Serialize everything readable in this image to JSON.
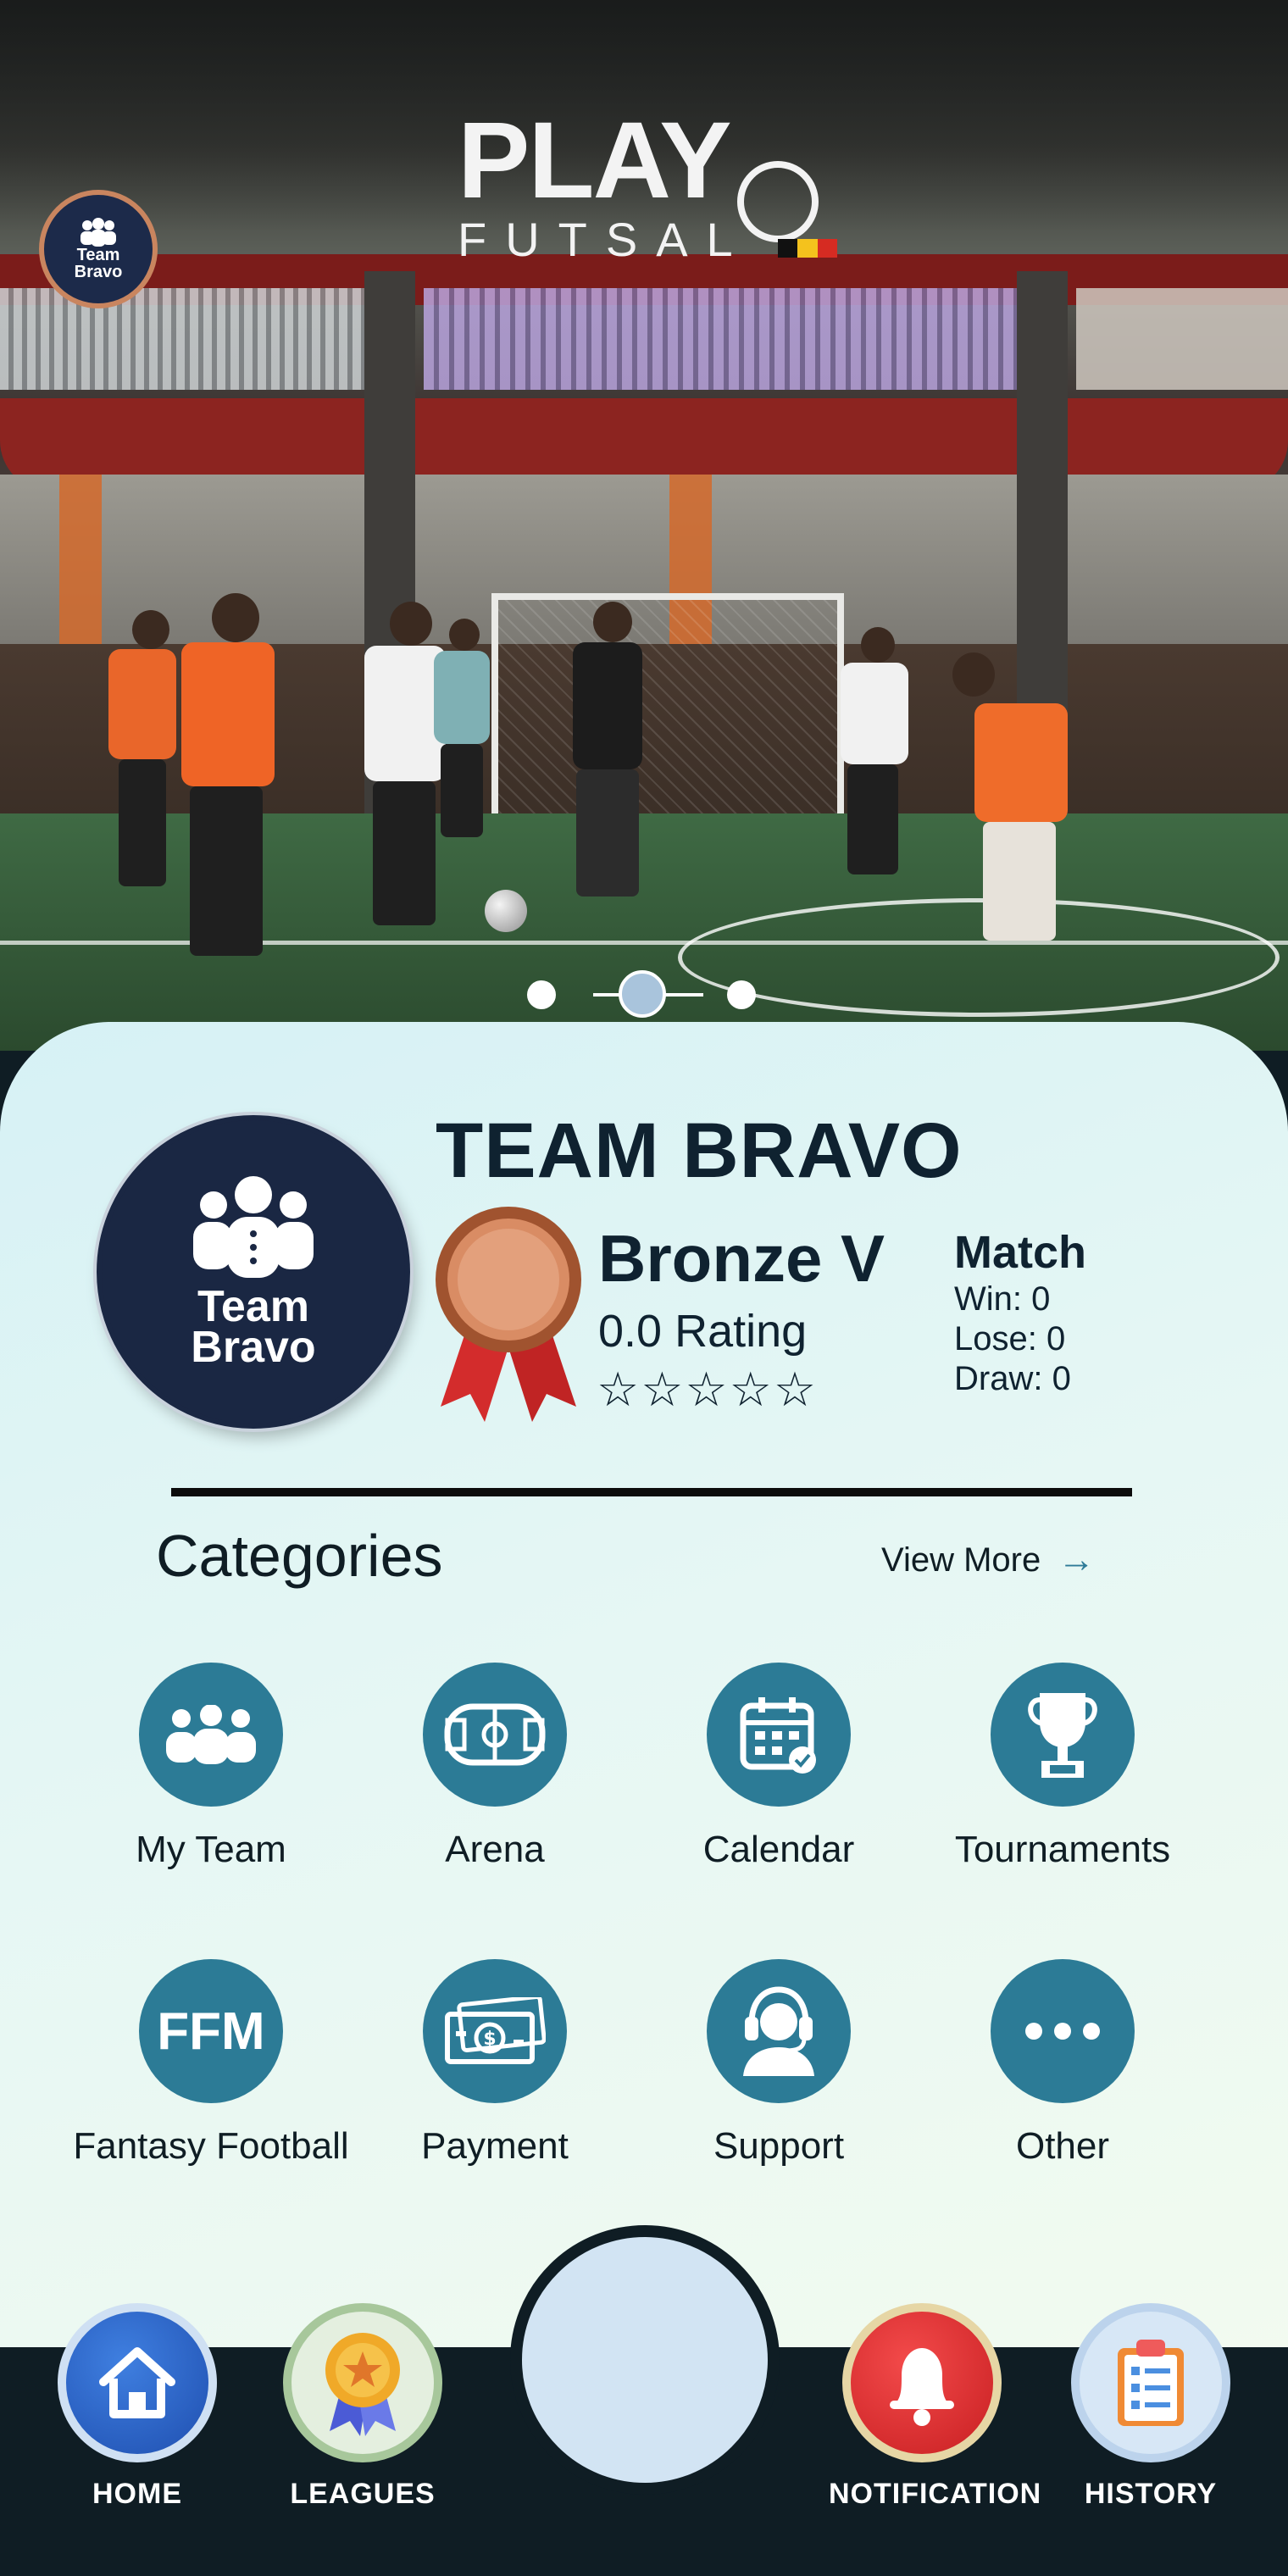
{
  "header": {
    "logo_main": "PLAY",
    "logo_sub": "FUTSAL",
    "team_badge_text": "Team Bravo"
  },
  "carousel": {
    "slide_count": 3,
    "active_index": 1
  },
  "team": {
    "name": "TEAM BRAVO",
    "emblem_line1": "Team",
    "emblem_line2": "Bravo",
    "rank": "Bronze V",
    "rating": "0.0 Rating",
    "stars": "☆☆☆☆☆",
    "match": {
      "title": "Match",
      "win": "Win: 0",
      "lose": "Lose: 0",
      "draw": "Draw: 0"
    }
  },
  "categories": {
    "heading": "Categories",
    "view_more": "View More",
    "items": [
      {
        "label": "My Team",
        "icon": "team-icon"
      },
      {
        "label": "Arena",
        "icon": "field-icon"
      },
      {
        "label": "Calendar",
        "icon": "calendar-icon"
      },
      {
        "label": "Tournaments",
        "icon": "trophy-icon"
      },
      {
        "label": "Fantasy Football",
        "icon": "ffm-icon",
        "icon_text": "FFM"
      },
      {
        "label": "Payment",
        "icon": "cash-icon"
      },
      {
        "label": "Support",
        "icon": "headset-icon"
      },
      {
        "label": "Other",
        "icon": "more-icon"
      }
    ]
  },
  "nav": {
    "items": [
      {
        "label": "HOME",
        "icon": "home-icon"
      },
      {
        "label": "LEAGUES",
        "icon": "medal-icon"
      },
      {
        "label": "NOTIFICATION",
        "icon": "bell-icon"
      },
      {
        "label": "HISTORY",
        "icon": "clipboard-icon"
      }
    ]
  },
  "colors": {
    "accent": "#2c7b96",
    "navy": "#1a2743",
    "dark": "#0f1d24",
    "bronze": "#c9855f"
  }
}
